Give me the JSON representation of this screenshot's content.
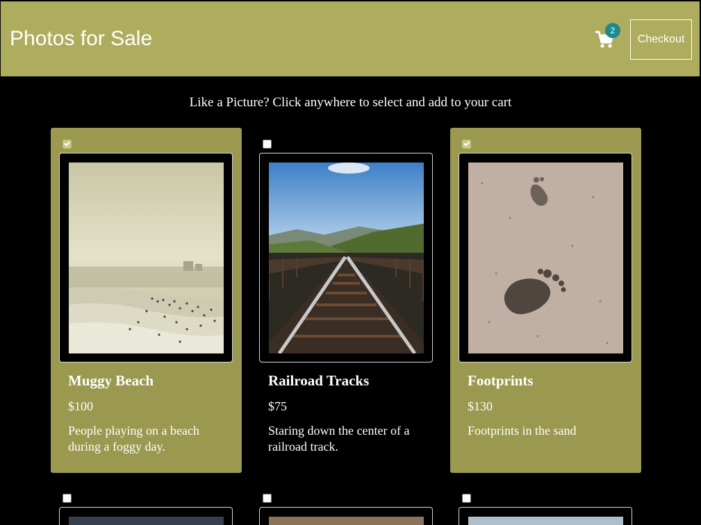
{
  "header": {
    "title": "Photos for Sale",
    "cart_count": "2",
    "checkout_label": "Checkout"
  },
  "instructions": "Like a Picture? Click anywhere to select and add to your cart",
  "colors": {
    "header_bg": "#aead5d",
    "selected_card_bg": "#9a994f",
    "badge_bg": "#1b8a91",
    "page_bg": "#000000"
  },
  "icons": [
    "cart-icon",
    "checkbox-icon"
  ],
  "products": [
    {
      "title": "Muggy Beach",
      "price": "$100",
      "description": "People playing on a beach during a foggy day.",
      "selected": true
    },
    {
      "title": "Railroad Tracks",
      "price": "$75",
      "description": "Staring down the center of a railroad track.",
      "selected": false
    },
    {
      "title": "Footprints",
      "price": "$130",
      "description": "Footprints in the sand",
      "selected": true
    }
  ],
  "second_row": [
    {
      "selected": false
    },
    {
      "selected": false
    },
    {
      "selected": false
    }
  ]
}
